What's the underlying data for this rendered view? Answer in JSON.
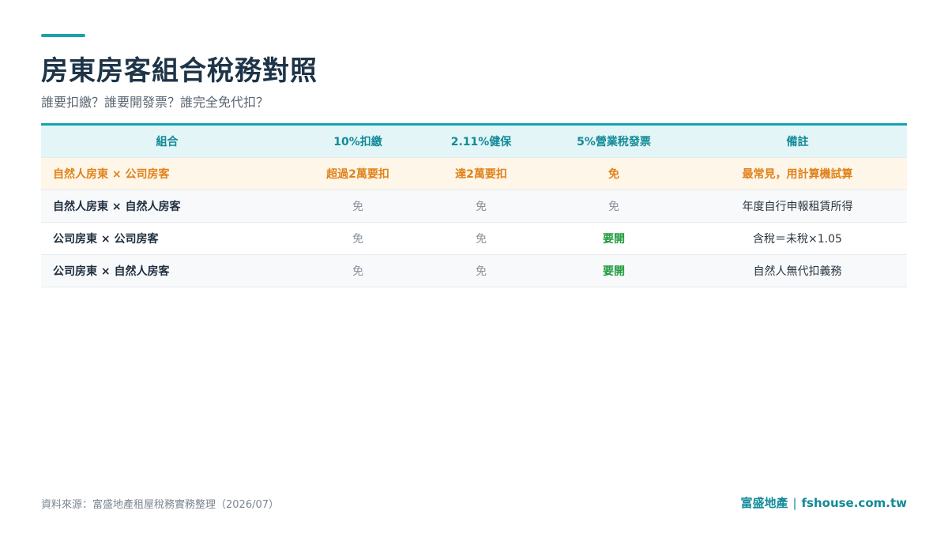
{
  "title": "房東房客組合稅務對照",
  "subtitle": "誰要扣繳？誰要開發票？誰完全免代扣？",
  "table": {
    "headers": [
      "組合",
      "10%扣繳",
      "2.11%健保",
      "5%營業稅發票",
      "備註"
    ],
    "rows": [
      [
        "自然人房東 × 公司房客",
        "超過2萬要扣",
        "達2萬要扣",
        "免",
        "最常見，用計算機試算"
      ],
      [
        "自然人房東 × 自然人房客",
        "免",
        "免",
        "免",
        "年度自行申報租賃所得"
      ],
      [
        "公司房東 × 公司房客",
        "免",
        "免",
        "要開",
        "含稅＝未稅×1.05"
      ],
      [
        "公司房東 × 自然人房客",
        "免",
        "免",
        "要開",
        "自然人無代扣義務"
      ]
    ]
  },
  "footer": {
    "source": "資料來源：富盛地產租屋稅務實務整理（2026/07）",
    "brand": "富盛地產",
    "separator": "|",
    "site": "fshouse.com.tw"
  },
  "colors": {
    "accent": "#17a2b0",
    "header_text": "#128a99",
    "highlight_text": "#e0821a",
    "highlight_bg": "#fef6e9",
    "must_text": "#1e9a3a"
  }
}
